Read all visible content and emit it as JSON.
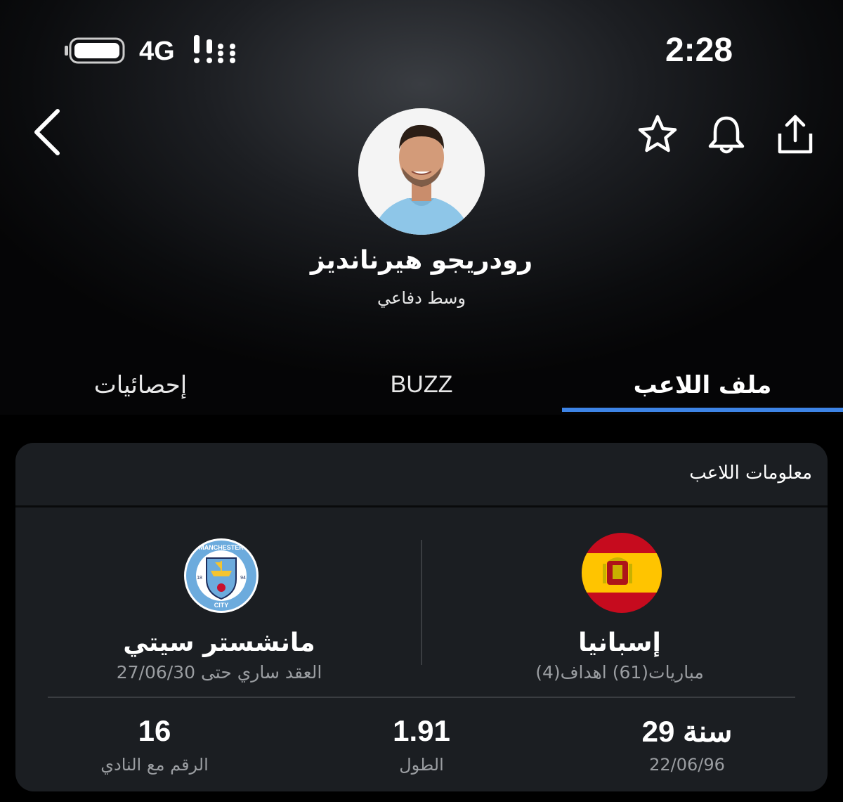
{
  "status_bar": {
    "time": "2:28",
    "network": "4G",
    "icons": [
      "battery-icon",
      "signal-icon"
    ]
  },
  "nav": {
    "icons": [
      "back-icon",
      "star-icon",
      "bell-icon",
      "share-icon"
    ]
  },
  "player": {
    "name": "رودريجو هيرنانديز",
    "position": "وسط دفاعي"
  },
  "tabs": [
    {
      "label": "ملف اللاعب",
      "active": true
    },
    {
      "label": "BUZZ",
      "active": false
    },
    {
      "label": "إحصائيات",
      "active": false
    }
  ],
  "info_card": {
    "title": "معلومات اللاعب",
    "national": {
      "name": "إسبانيا",
      "detail": "مباريات(61) اهداف(4)",
      "icon": "spain-flag-icon"
    },
    "club": {
      "name": "مانشستر سيتي",
      "detail": "العقد ساري حتى 27/06/30",
      "icon": "manchester-city-crest-icon",
      "crest_text_top": "MANCHESTER",
      "crest_text_bottom": "CITY",
      "crest_year_left": "18",
      "crest_year_right": "94"
    },
    "stats": [
      {
        "value": "29 سنة",
        "label": "22/06/96"
      },
      {
        "value": "1.91",
        "label": "الطول"
      },
      {
        "value": "16",
        "label": "الرقم مع النادي"
      }
    ]
  },
  "colors": {
    "accent": "#3d84e6",
    "card_bg": "#1b1e22",
    "muted_text": "#9a9da1"
  }
}
